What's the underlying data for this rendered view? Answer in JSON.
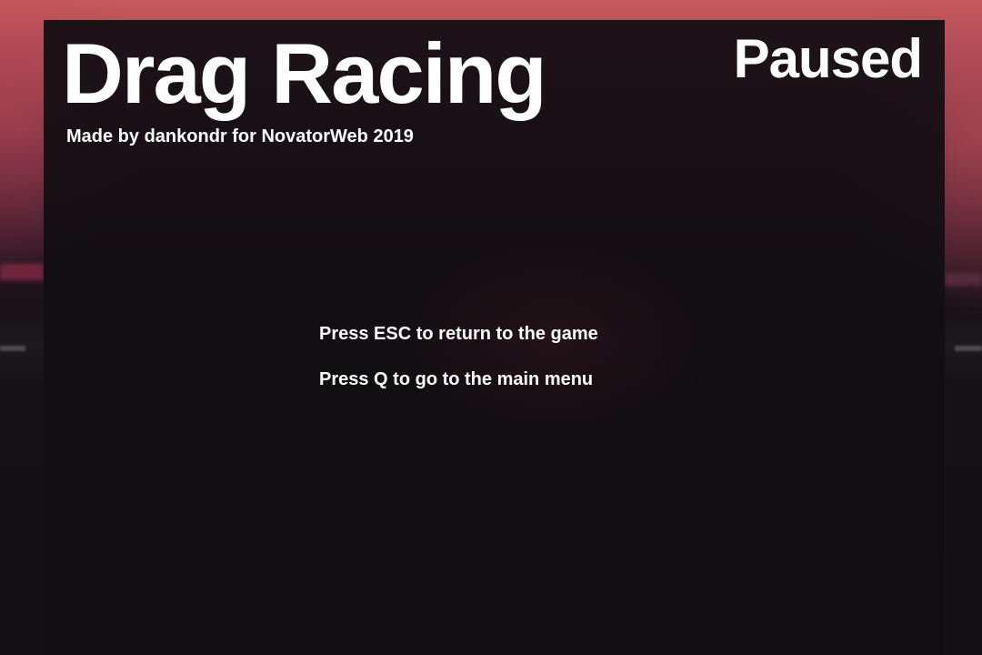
{
  "game": {
    "title": "Drag Racing",
    "credit": "Made by dankondr for NovatorWeb 2019",
    "status": "Paused"
  },
  "pause_menu": {
    "instructions": [
      "Press ESC to return to the game",
      "Press Q to go to the main menu"
    ]
  },
  "colors": {
    "text": "#ffffff",
    "overlay": "#110e12",
    "background_accent": "#c65a5e"
  }
}
